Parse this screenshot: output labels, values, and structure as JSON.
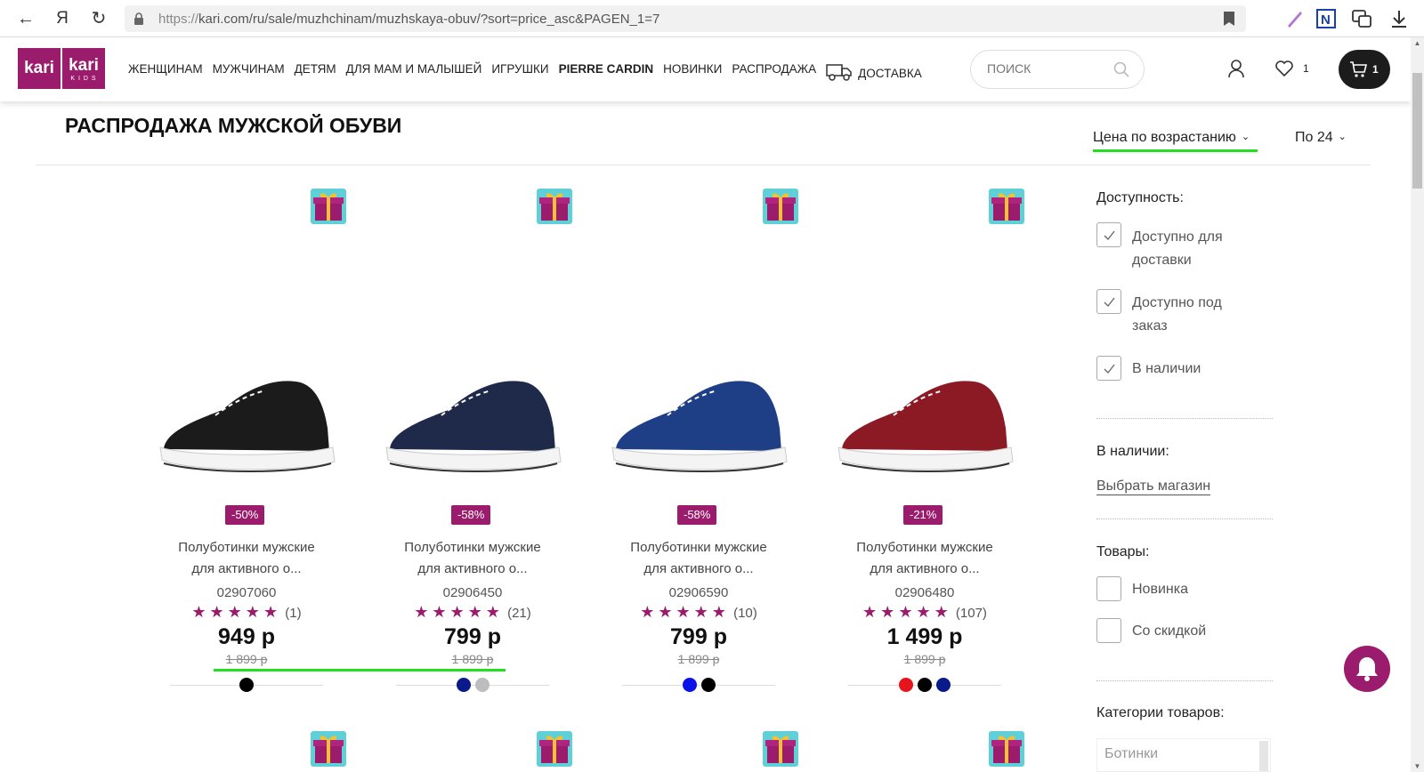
{
  "browser": {
    "url_proto": "https://",
    "url_rest": "kari.com/ru/sale/muzhchinam/muzhskaya-obuv/?sort=price_asc&PAGEN_1=7"
  },
  "header": {
    "logo_left": "kari",
    "logo_right": "kari",
    "logo_right_sub": "K I D S",
    "nav": [
      "ЖЕНЩИНАМ",
      "МУЖЧИНАМ",
      "ДЕТЯМ",
      "ДЛЯ МАМ И МАЛЫШЕЙ",
      "ИГРУШКИ",
      "PIERRE CARDIN",
      "НОВИНКИ",
      "РАСПРОДАЖА",
      "ДОСТАВКА"
    ],
    "search_placeholder": "ПОИСК",
    "favorites_count": "1",
    "cart_count": "1"
  },
  "page": {
    "title": "РАСПРОДАЖА МУЖСКОЙ ОБУВИ",
    "sort_label": "Цена по возрастанию",
    "perpage_label": "По 24"
  },
  "products": [
    {
      "discount": "-50%",
      "name_line1": "Полуботинки мужские",
      "name_line2": "для активного о...",
      "code": "02907060",
      "stars": "★★★★★",
      "reviews": "(1)",
      "price": "949 р",
      "old_price": "1 899 р",
      "colors": [
        "#000000"
      ],
      "shoe_color": "#1b1b1b"
    },
    {
      "discount": "-58%",
      "name_line1": "Полуботинки мужские",
      "name_line2": "для активного о...",
      "code": "02906450",
      "stars": "★★★★★",
      "reviews": "(21)",
      "price": "799 р",
      "old_price": "1 899 р",
      "colors": [
        "#0a1a8a",
        "#bdbdbd"
      ],
      "shoe_color": "#1f2a4a"
    },
    {
      "discount": "-58%",
      "name_line1": "Полуботинки мужские",
      "name_line2": "для активного о...",
      "code": "02906590",
      "stars": "★★★★★",
      "reviews": "(10)",
      "price": "799 р",
      "old_price": "1 899 р",
      "colors": [
        "#0a12e8",
        "#000000"
      ],
      "shoe_color": "#1e3f86"
    },
    {
      "discount": "-21%",
      "name_line1": "Полуботинки мужские",
      "name_line2": "для активного о...",
      "code": "02906480",
      "stars": "★★★★★",
      "reviews": "(107)",
      "price": "1 499 р",
      "old_price": "1 899 р",
      "colors": [
        "#e8141c",
        "#000000",
        "#0a1a8a"
      ],
      "shoe_color": "#8c1a24"
    }
  ],
  "filters": {
    "availability_title": "Доступность:",
    "availability": [
      {
        "label_line1": "Доступно для",
        "label_line2": "доставки",
        "checked": true
      },
      {
        "label_line1": "Доступно под",
        "label_line2": "заказ",
        "checked": true
      },
      {
        "label_line1": "В наличии",
        "label_line2": "",
        "checked": true
      }
    ],
    "in_stock_title": "В наличии:",
    "store_link": "Выбрать магазин",
    "goods_title": "Товары:",
    "goods": [
      {
        "label": "Новинка",
        "checked": false
      },
      {
        "label": "Со скидкой",
        "checked": false
      }
    ],
    "categories_title": "Категории товаров:",
    "categories": [
      "Ботинки"
    ]
  },
  "colors": {
    "brand": "#9b1c6c",
    "highlight": "#22e01f"
  }
}
